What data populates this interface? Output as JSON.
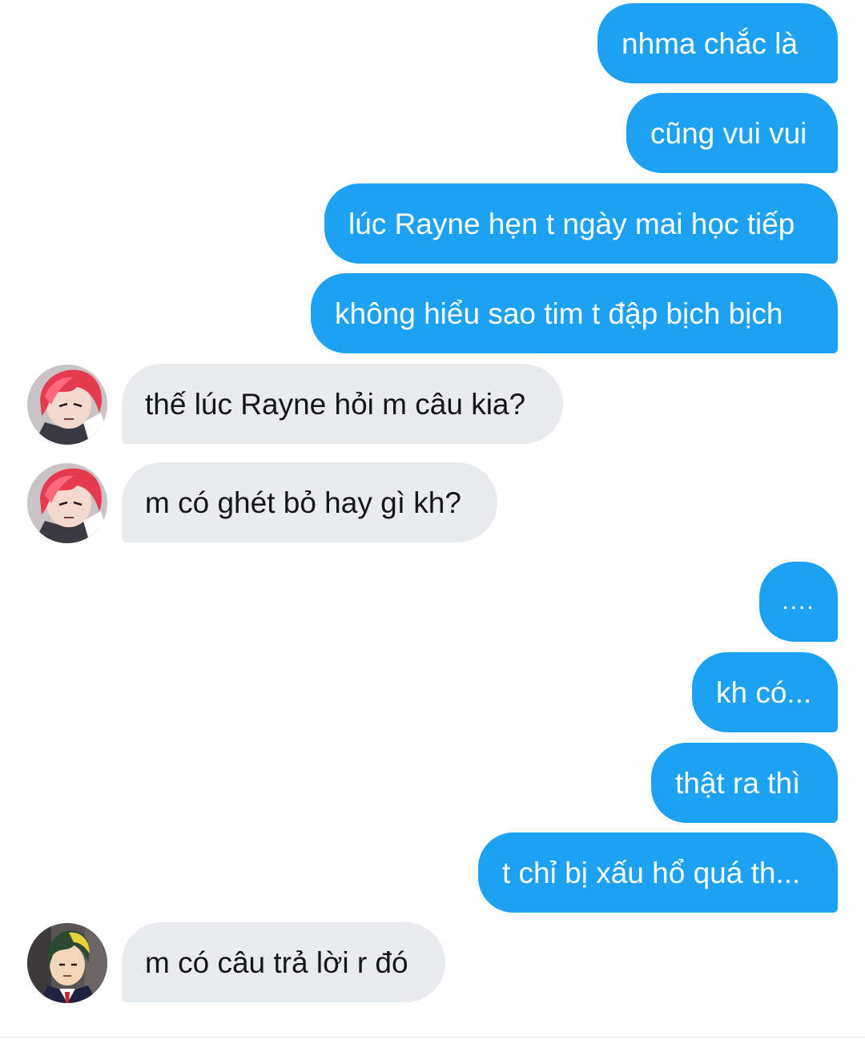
{
  "messages": [
    {
      "side": "out",
      "text": "nhma chắc là"
    },
    {
      "side": "out",
      "text": "cũng vui vui"
    },
    {
      "side": "out",
      "text": "lúc Rayne hẹn t ngày mai học tiếp"
    },
    {
      "side": "out",
      "text": "không hiểu sao tim t đập bịch bịch"
    },
    {
      "side": "in",
      "text": "thế lúc Rayne hỏi m câu kia?",
      "avatar": "red-hair-avatar"
    },
    {
      "side": "in",
      "text": "m có ghét bỏ hay gì kh?",
      "avatar": "red-hair-avatar"
    },
    {
      "side": "out",
      "text": "...."
    },
    {
      "side": "out",
      "text": "kh có..."
    },
    {
      "side": "out",
      "text": "thật ra thì"
    },
    {
      "side": "out",
      "text": "t chỉ bị xấu hổ quá th..."
    },
    {
      "side": "in",
      "text": "m có câu trả lời r đó",
      "avatar": "green-hair-avatar"
    }
  ],
  "colors": {
    "outgoing_bubble": "#1da1f2",
    "incoming_bubble": "#e8ecef",
    "outgoing_text": "#ffffff",
    "incoming_text": "#14171a"
  }
}
